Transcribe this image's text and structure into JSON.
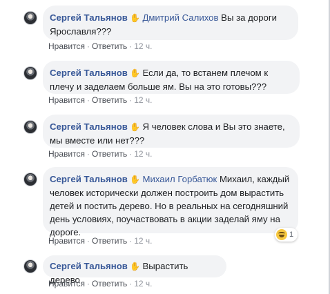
{
  "comments": [
    {
      "author": "Сергей Тальянов",
      "mention": "Дмитрий Салихов",
      "text": " Вы за дороги Ярославля???",
      "like": "Нравится",
      "reply": "Ответить",
      "time": "12 ч."
    },
    {
      "author": "Сергей Тальянов",
      "mention": "",
      "text": "Если да, то встанем плечом к плечу и заделаем больше ям. Вы на это готовы???",
      "like": "Нравится",
      "reply": "Ответить",
      "time": "12 ч."
    },
    {
      "author": "Сергей Тальянов",
      "mention": "",
      "text": "Я человек слова и Вы это знаете, мы вместе или нет???",
      "like": "Нравится",
      "reply": "Ответить",
      "time": "12 ч."
    },
    {
      "author": "Сергей Тальянов",
      "mention": "Михаил Горбатюк",
      "text": " Михаил, каждый человек исторически должен построить дом вырастить детей и постить дерево. Но в реальных на сегодняшний день условиях, поучаствовать в акции заделай яму на дороге.",
      "like": "Нравится",
      "reply": "Ответить",
      "time": "12 ч.",
      "reaction_count": "1",
      "reaction_icon": "laugh-reaction-icon"
    },
    {
      "author": "Сергей Тальянов",
      "mention": "",
      "text": "Вырастить дерево",
      "like": "Нравится",
      "reply": "Ответить",
      "time": "12 ч."
    }
  ],
  "separator": "·",
  "hand_icon": "waving-hand-icon",
  "colors": {
    "link": "#385898",
    "bubble": "#f2f3f5",
    "meta": "#90949c"
  }
}
